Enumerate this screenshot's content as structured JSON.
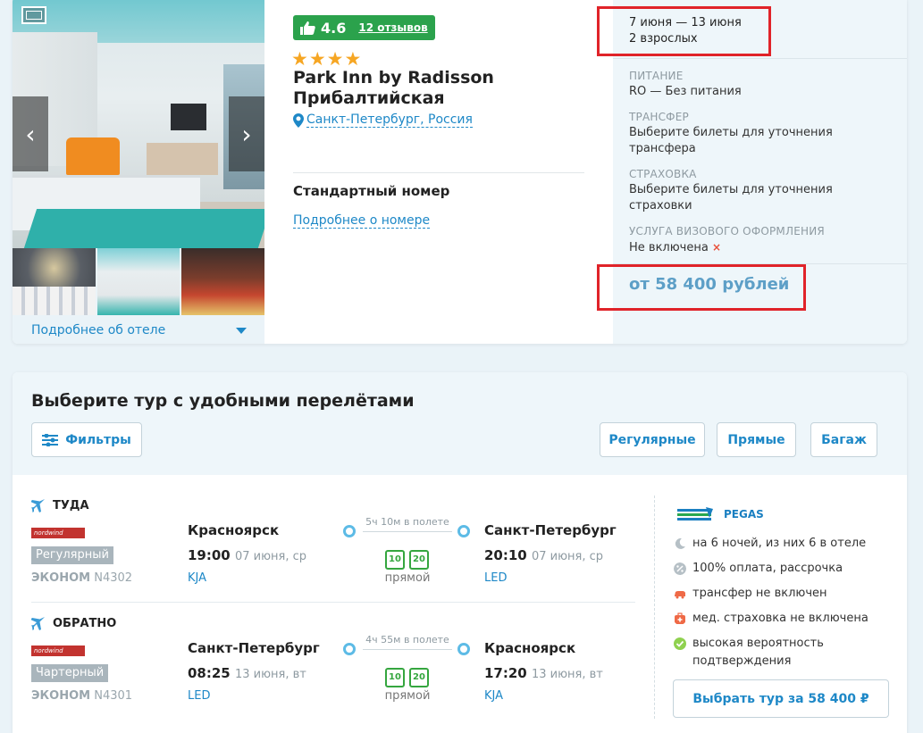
{
  "hotel": {
    "rating": "4.6",
    "reviews": "12 отзывов",
    "stars": "★★★★",
    "name": "Park Inn by Radisson Прибалтийская",
    "location": "Санкт-Петербург, Россия",
    "room_type": "Стандартный номер",
    "room_more": "Подробнее о номере",
    "more_hotel": "Подробнее об отеле",
    "arrow_left": "‹",
    "arrow_right": "›"
  },
  "booking": {
    "dates": "7 июня — 13 июня",
    "guests": "2 взрослых",
    "meal_label": "ПИТАНИЕ",
    "meal_value": "RO — Без питания",
    "transfer_label": "ТРАНСФЕР",
    "transfer_value": "Выберите билеты для уточнения трансфера",
    "insurance_label": "СТРАХОВКА",
    "insurance_value": "Выберите билеты для уточнения страховки",
    "visa_label": "УСЛУГА ВИЗОВОГО ОФОРМЛЕНИЯ",
    "visa_value": "Не включена",
    "visa_mark": "×",
    "price": "от 58 400 рублей"
  },
  "tours": {
    "title": "Выберите тур с удобными перелётами",
    "filters": "Фильтры",
    "regular": "Регулярные",
    "direct": "Прямые",
    "baggage": "Багаж",
    "outbound": {
      "label": "ТУДА",
      "airline": "nordwind airlines",
      "type": "Регулярный",
      "class": "ЭКОНОМ",
      "flight": "N4302",
      "from_city": "Красноярск",
      "from_time": "19:00",
      "from_date": "07 июня, ср",
      "from_code": "KJA",
      "duration": "5ч 10м в полете",
      "bag1": "10",
      "bag2": "20",
      "direct": "прямой",
      "to_city": "Санкт-Петербург",
      "to_time": "20:10",
      "to_date": "07 июня, ср",
      "to_code": "LED"
    },
    "inbound": {
      "label": "ОБРАТНО",
      "airline": "nordwind airlines",
      "type": "Чартерный",
      "class": "ЭКОНОМ",
      "flight": "N4301",
      "from_city": "Санкт-Петербург",
      "from_time": "08:25",
      "from_date": "13 июня, вт",
      "from_code": "LED",
      "duration": "4ч 55м в полете",
      "bag1": "10",
      "bag2": "20",
      "direct": "прямой",
      "to_city": "Красноярск",
      "to_time": "17:20",
      "to_date": "13 июня, вт",
      "to_code": "KJA"
    },
    "operator": "PEGAS",
    "features": {
      "nights": "на 6 ночей, из них 6 в отеле",
      "payment": "100% оплата, рассрочка",
      "transfer": "трансфер не включен",
      "insurance": "мед. страховка не включена",
      "confirm": "высокая вероятность подтверждения"
    },
    "choose": "Выбрать тур за 58 400 ₽"
  },
  "colors": {
    "accent": "#1e88c7",
    "rating_bg": "#2ba24c",
    "highlight": "#e02329",
    "star": "#f6a623"
  }
}
